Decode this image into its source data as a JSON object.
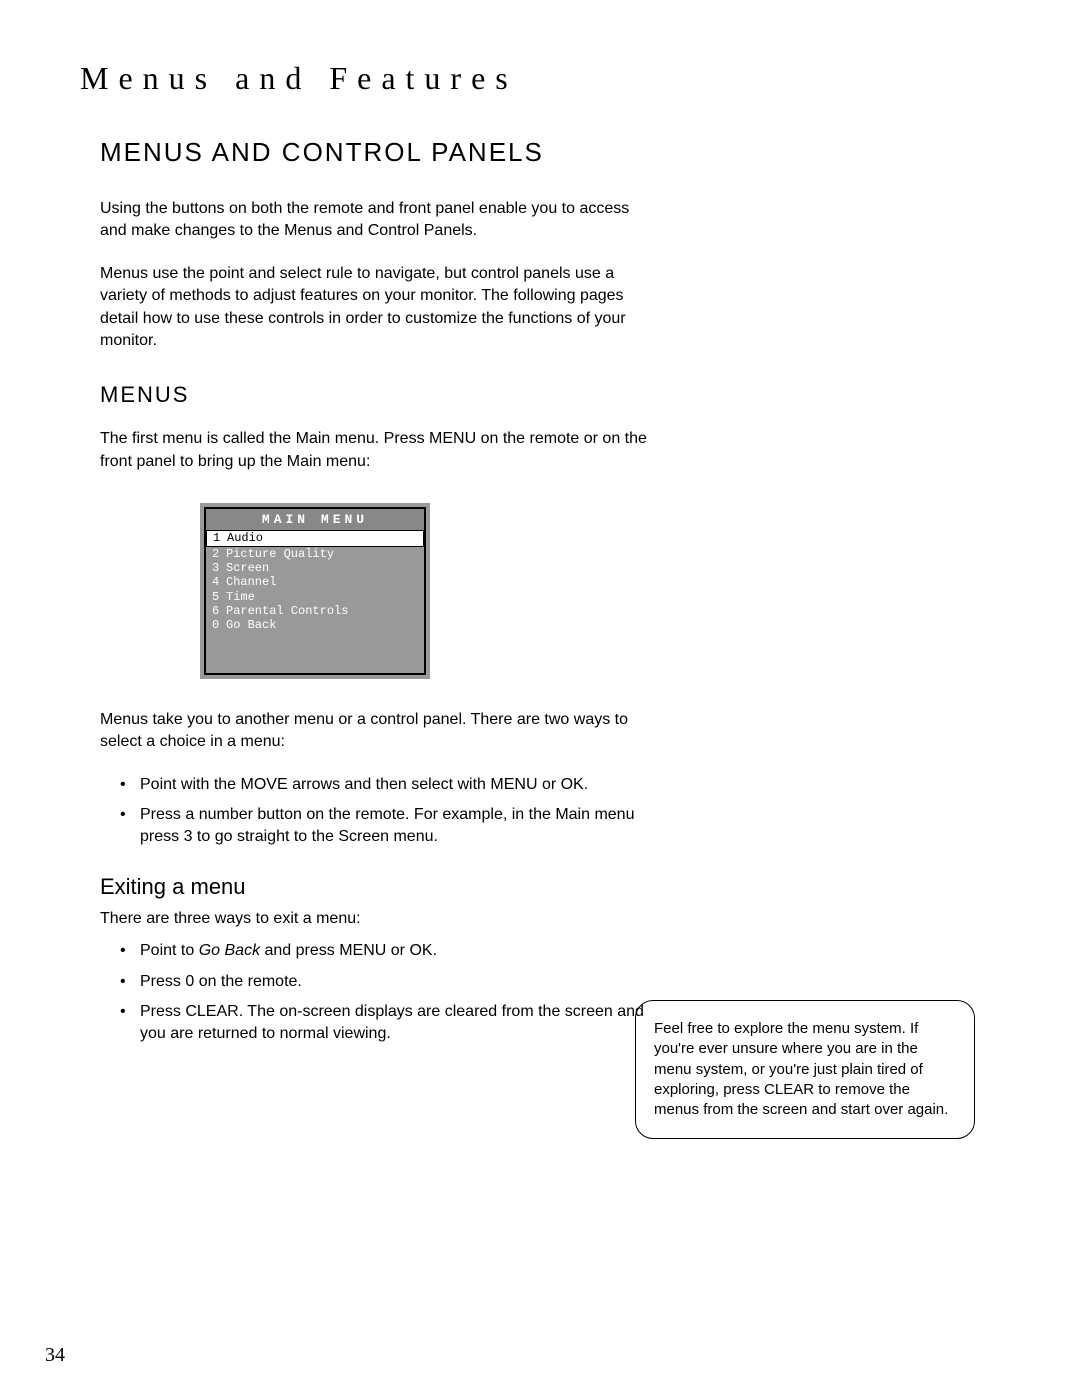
{
  "chapter_title": "Menus and Features",
  "section_heading": "MENUS AND CONTROL PANELS",
  "intro_p1": "Using the buttons on both the remote and front panel enable you to access and make changes to the Menus and Control Panels.",
  "intro_p2": "Menus use the point and select rule to navigate, but control panels use a variety of methods to adjust features on your monitor. The following pages detail how to use these controls in order to customize the functions of your monitor.",
  "menus_heading": "MENUS",
  "menus_p1": "The first menu is called the Main menu. Press MENU on the remote or on the front panel to bring up the Main menu:",
  "main_menu": {
    "title": "MAIN MENU",
    "items": [
      {
        "num": "1",
        "label": "Audio",
        "selected": true
      },
      {
        "num": "2",
        "label": "Picture Quality",
        "selected": false
      },
      {
        "num": "3",
        "label": "Screen",
        "selected": false
      },
      {
        "num": "4",
        "label": "Channel",
        "selected": false
      },
      {
        "num": "5",
        "label": "Time",
        "selected": false
      },
      {
        "num": "6",
        "label": "Parental Controls",
        "selected": false
      },
      {
        "num": "0",
        "label": "Go Back",
        "selected": false
      }
    ]
  },
  "menus_p2": "Menus take you to another menu or a control panel. There are two ways to select a choice in a menu:",
  "select_bullets": [
    "Point with the MOVE arrows and then select with MENU or OK.",
    "Press a number button on the remote. For example, in the Main menu press 3 to go straight to the Screen menu."
  ],
  "exiting_heading": "Exiting a menu",
  "exiting_p": "There are three ways to exit a menu:",
  "exit_bullets": [
    {
      "pre": "Point to ",
      "em": "Go Back",
      "post": " and press MENU or OK."
    },
    {
      "pre": "Press 0 on the remote.",
      "em": "",
      "post": ""
    },
    {
      "pre": "Press CLEAR. The on-screen displays are cleared from the screen and you are returned to normal viewing.",
      "em": "",
      "post": ""
    }
  ],
  "tip_text": "Feel free to explore the menu system. If you're ever unsure where you are in the menu system, or you're just plain tired of exploring, press CLEAR to remove the menus from the screen and start over again.",
  "page_number": "34"
}
